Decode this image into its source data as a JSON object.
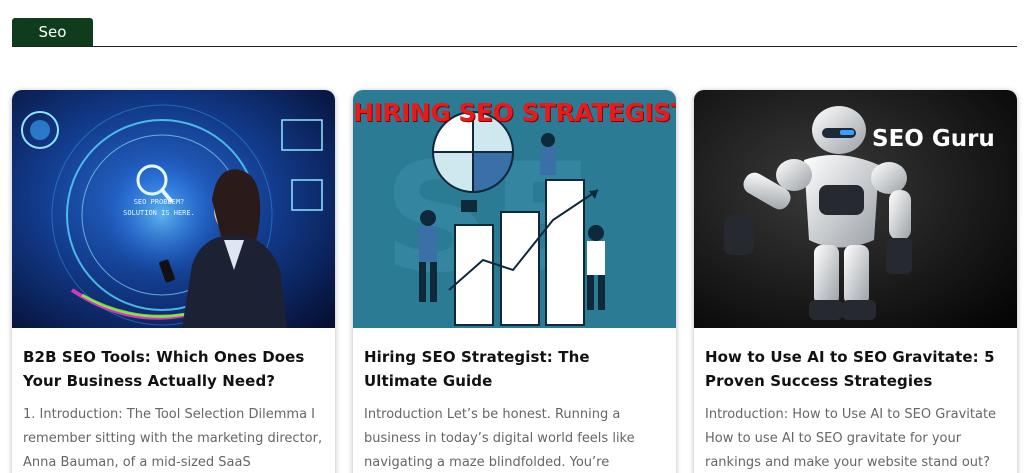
{
  "category": {
    "label": "Seo"
  },
  "posts": [
    {
      "title": "B2B SEO Tools: Which Ones Does Your Business Actually Need?",
      "excerpt": "1. Introduction: The Tool Selection Dilemma I remember sitting with the marketing director, Anna Bauman, of a mid-sized SaaS",
      "image": {
        "kind": "holographic-businesswoman",
        "caption_text": "SEO PROBLEM? SOLUTION IS HERE."
      }
    },
    {
      "title": "Hiring SEO Strategist: The Ultimate Guide",
      "excerpt": "Introduction Let’s be honest. Running a business in today’s digital world feels like navigating a maze blindfolded. You’re",
      "image": {
        "kind": "growth-chart-illustration",
        "overlay_text": "HIRING SEO STRATEGIST"
      }
    },
    {
      "title": "How to Use AI to SEO Gravitate: 5 Proven Success Strategies",
      "excerpt": "Introduction: How to Use AI to SEO Gravitate How to use AI to SEO gravitate for your rankings and make your website stand out?",
      "image": {
        "kind": "robot-photo",
        "overlay_text": "SEO Guru"
      }
    }
  ]
}
